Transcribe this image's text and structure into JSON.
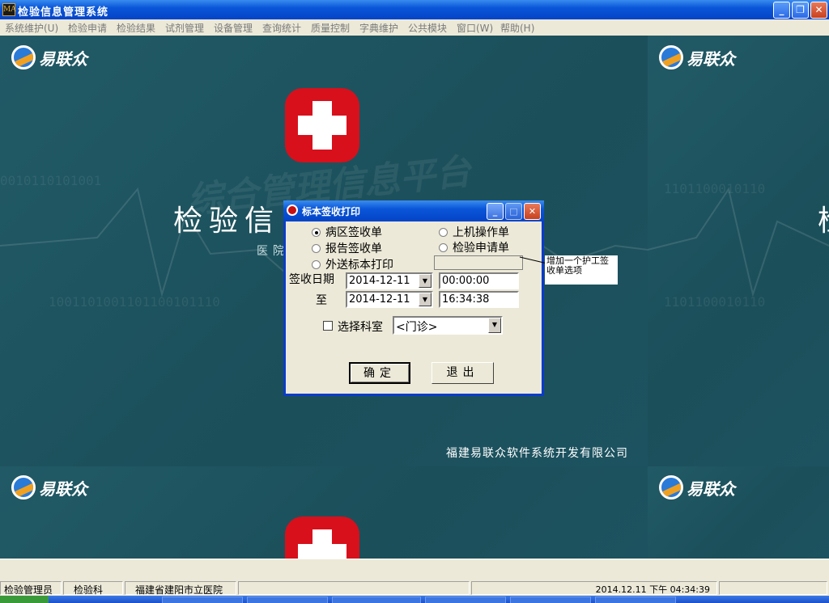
{
  "window": {
    "title": "检验信息管理系统",
    "icon_label": "MA"
  },
  "menu": [
    "系统维护(U)",
    "检验申请",
    "检验结果",
    "试剂管理",
    "设备管理",
    "查询统计",
    "质量控制",
    "字典维护",
    "公共模块",
    "窗口(W)",
    "帮助(H)"
  ],
  "background": {
    "logo_text": "易联众",
    "big_title": "检验信",
    "right_edge_char": "检",
    "subtitle": "医院",
    "watermark": "综合管理信息平台",
    "binary_rows": [
      "0010110101001",
      "1101100010110",
      "1001101001101100101110"
    ],
    "company": "福建易联众软件系统开发有限公司"
  },
  "dialog": {
    "title": "标本签收打印",
    "radios": [
      {
        "label": "病区签收单",
        "checked": true
      },
      {
        "label": "报告签收单",
        "checked": false
      },
      {
        "label": "外送标本打印",
        "checked": false
      },
      {
        "label": "上机操作单",
        "checked": false
      },
      {
        "label": "检验申请单",
        "checked": false
      }
    ],
    "sign_date_label": "签收日期",
    "to_label": "至",
    "date_from": "2014-12-11",
    "time_from": "00:00:00",
    "date_to": "2014-12-11",
    "time_to": "16:34:38",
    "dept_checkbox_label": "选择科室",
    "dept_value": "<门诊>",
    "ok_label": "确定",
    "exit_label": "退出",
    "dropdown_glyph": "▼"
  },
  "annotation": "增加一个护工签收单选项",
  "statusbar": {
    "user": "检验管理员",
    "dept": "检验科",
    "hospital": "福建省建阳市立医院",
    "datetime": "2014.12.11 下午 04:34:39"
  },
  "colors": {
    "desktop_bg": "#1e5560",
    "titlebar": "#0a56d8",
    "cross_red": "#d8101c"
  }
}
